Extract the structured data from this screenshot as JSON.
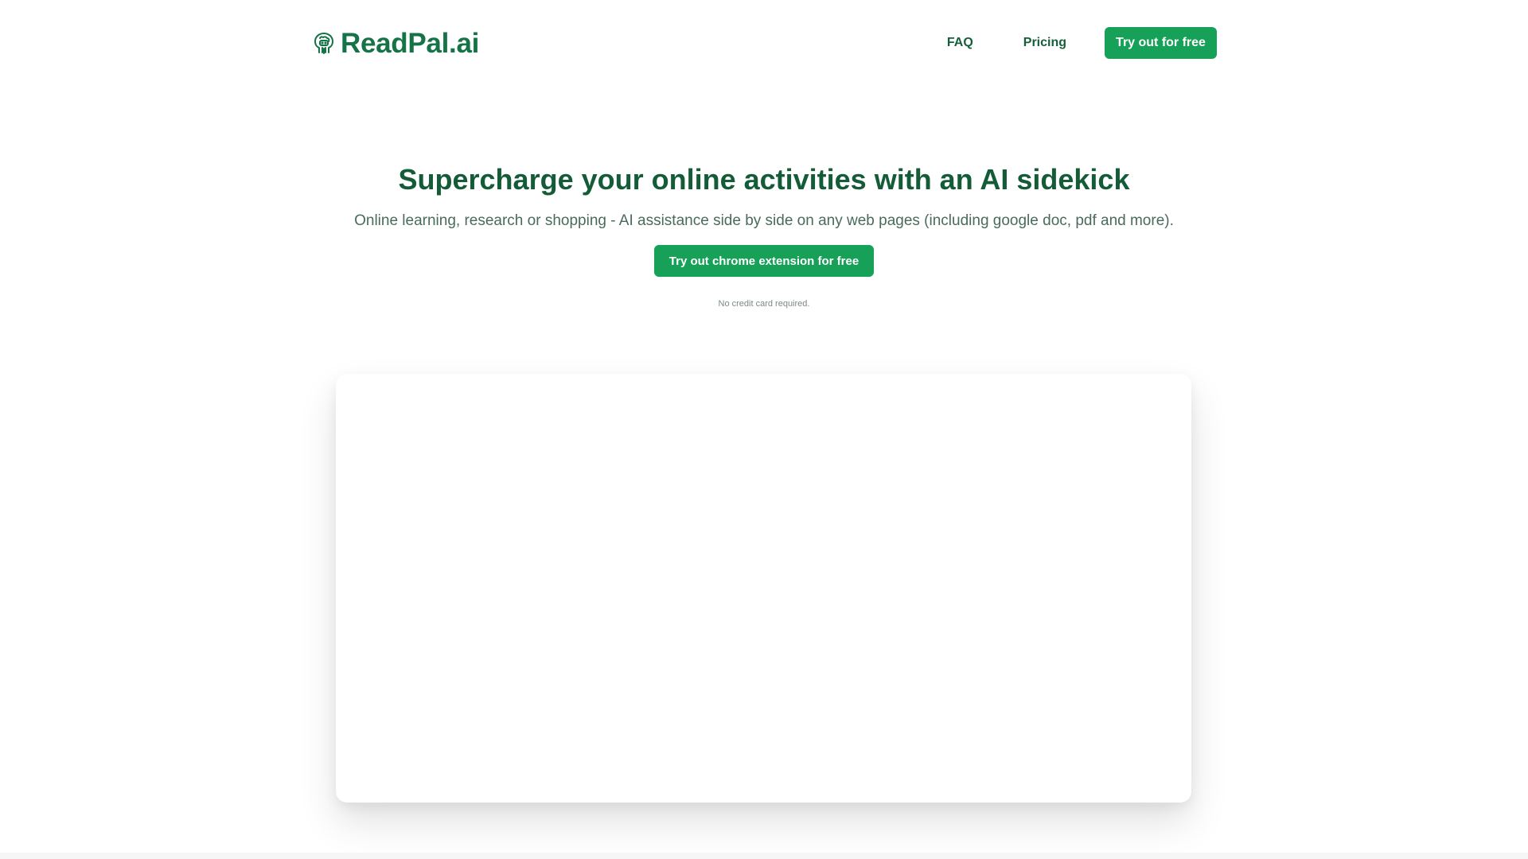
{
  "brand": {
    "name": "ReadPal.ai",
    "color": "#157347",
    "icon": "brain-chat-icon"
  },
  "nav": {
    "faq_label": "FAQ",
    "pricing_label": "Pricing",
    "cta_label": "Try out for free",
    "cta_color": "#16a058"
  },
  "hero": {
    "title": "Supercharge your online activities with an AI sidekick",
    "subtitle": "Online learning, research or shopping - AI assistance side by side on any web pages (including google doc, pdf and more).",
    "cta_label": "Try out chrome extension for free",
    "note": "No credit card required."
  }
}
